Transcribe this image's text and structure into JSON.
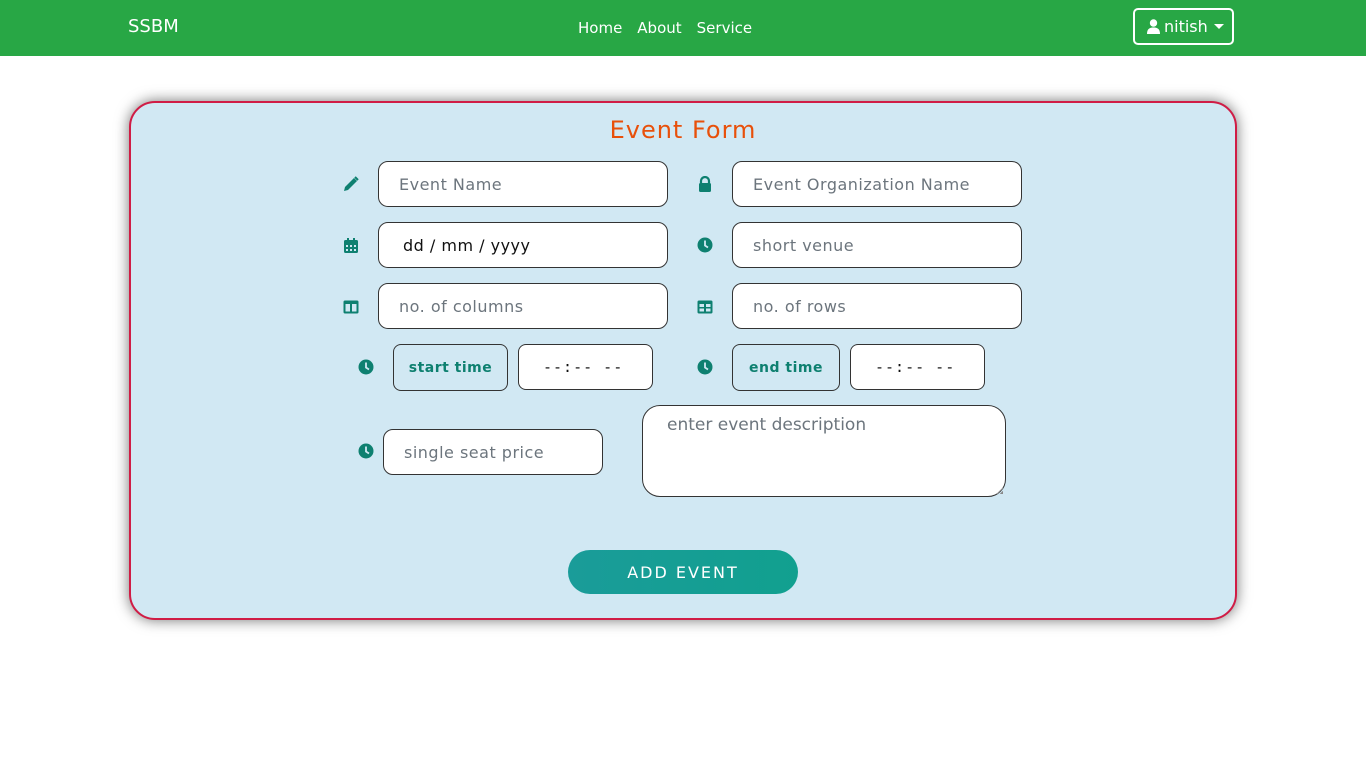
{
  "navbar": {
    "brand": "SSBM",
    "links": [
      "Home",
      "About",
      "Service"
    ],
    "user": "nitish"
  },
  "form": {
    "title": "Event Form",
    "event_name_placeholder": "Event Name",
    "org_name_placeholder": "Event Organization Name",
    "date_value": "dd / mm / yyyy",
    "venue_placeholder": "short venue",
    "columns_placeholder": "no. of columns",
    "rows_placeholder": "no. of rows",
    "start_time_label": "start time",
    "start_time_value": "--:-- --",
    "end_time_label": "end time",
    "end_time_value": "--:-- --",
    "seat_price_placeholder": "single seat price",
    "description_placeholder": "enter event description",
    "submit_label": "ADD EVENT"
  },
  "colors": {
    "navbar": "#28a745",
    "card_bg": "#d1e8f3",
    "card_border": "#d01c45",
    "title": "#e8500a",
    "icon": "#0e8070",
    "button": "#17a09a"
  },
  "icons": [
    "pencil-icon",
    "lock-icon",
    "calendar-icon",
    "clock-icon",
    "columns-icon",
    "table-icon",
    "user-icon"
  ]
}
